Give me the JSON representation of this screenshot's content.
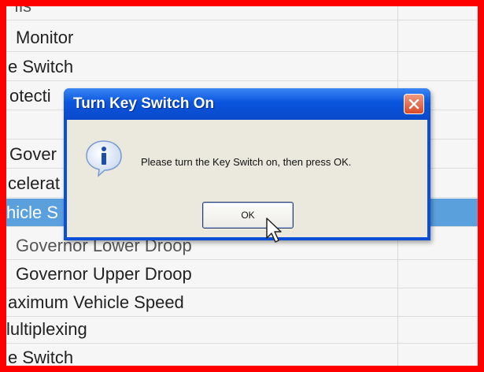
{
  "background_list": {
    "rows": [
      {
        "label": "ıls"
      },
      {
        "label": "Monitor"
      },
      {
        "label": "e Switch"
      },
      {
        "label": "otecti"
      },
      {
        "label": ""
      },
      {
        "label": "Gover"
      },
      {
        "label": "celerat"
      },
      {
        "label": "hicle S"
      },
      {
        "label": "Governor Lower Droop"
      },
      {
        "label": "Governor Upper Droop"
      },
      {
        "label": "aximum Vehicle Speed"
      },
      {
        "label": "lultiplexing"
      },
      {
        "label": "e Switch"
      }
    ]
  },
  "dialog": {
    "title": "Turn Key Switch On",
    "message": "Please turn the Key Switch on, then press OK.",
    "ok_label": "OK",
    "icon": "info-icon",
    "close_icon": "close-icon"
  },
  "colors": {
    "frame_border": "#ff0000",
    "titlebar": "#0a55de",
    "selected_row": "#5aa0dc",
    "dialog_body": "#ebe9dd",
    "close_button": "#d8492a"
  }
}
